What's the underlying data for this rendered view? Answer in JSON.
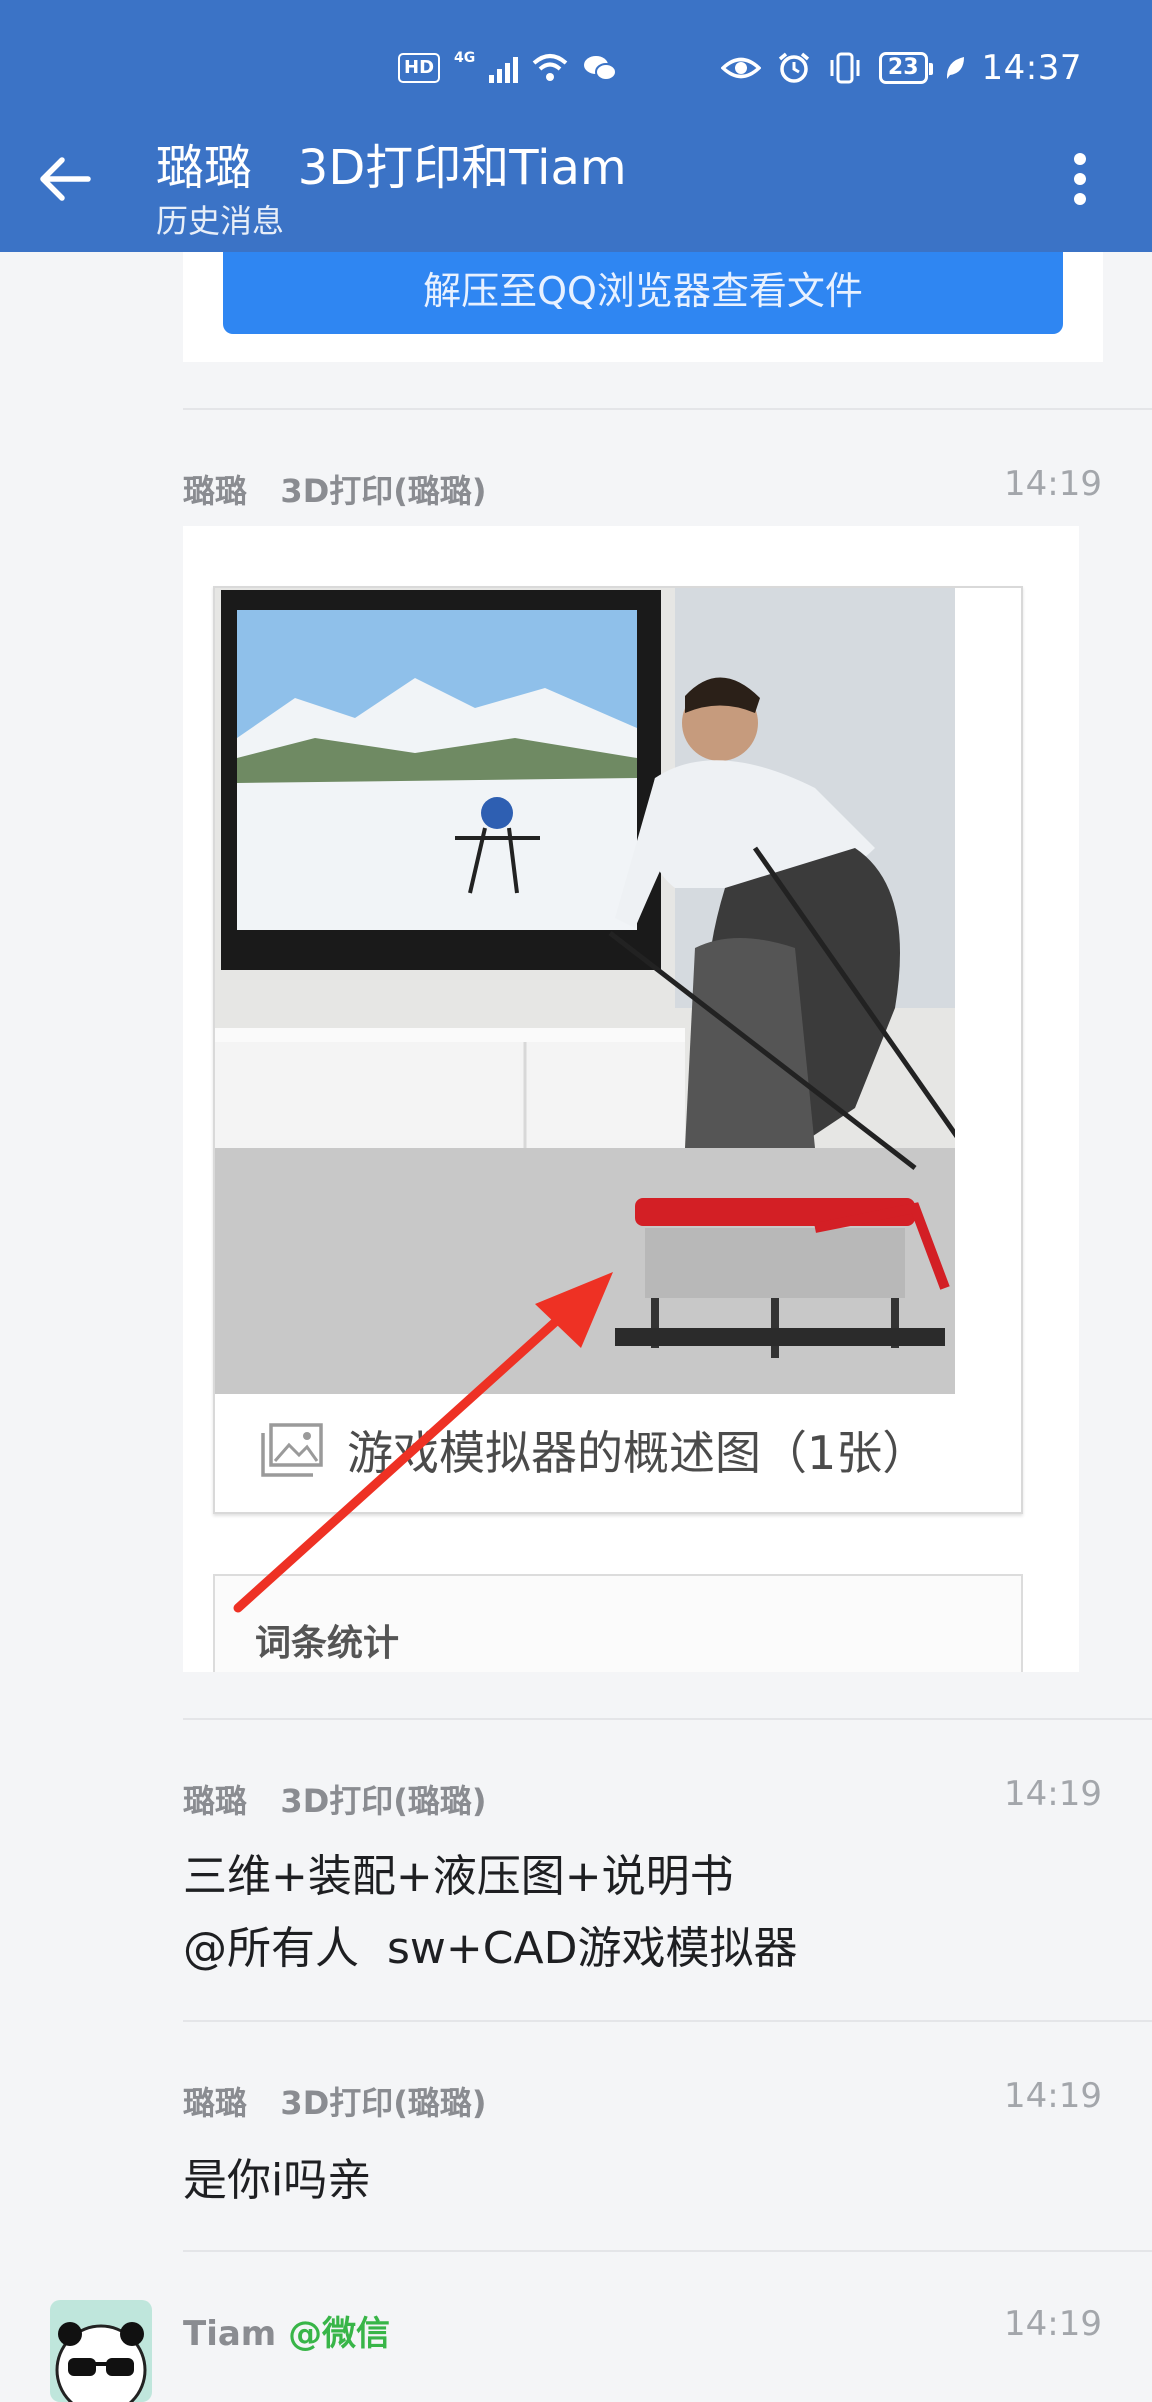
{
  "status_bar": {
    "hd": "HD",
    "network": "4G",
    "battery": "23",
    "time": "14:37"
  },
  "header": {
    "title": "璐璐   3D打印和Tiam",
    "subtitle": "历史消息"
  },
  "file_card": {
    "button_label": "解压至QQ浏览器查看文件"
  },
  "messages": [
    {
      "sender": "璐璐   3D打印(璐璐)",
      "time": "14:19",
      "type": "image",
      "image": {
        "caption": "游戏模拟器的概述图（1张）",
        "stats_title": "词条统计"
      }
    },
    {
      "sender": "璐璐   3D打印(璐璐)",
      "time": "14:19",
      "lines": [
        "三维+装配+液压图+说明书",
        "@所有人  sw+CAD游戏模拟器"
      ]
    },
    {
      "sender": "璐璐   3D打印(璐璐)",
      "time": "14:19",
      "lines": [
        "是你i吗亲"
      ]
    },
    {
      "sender": "Tiam",
      "sender_tag": "@微信",
      "time": "14:19"
    }
  ],
  "colors": {
    "header_bg": "#3b73c6",
    "button_bg": "#2f86f2",
    "wechat_tag": "#38b548",
    "arrow": "#ee3124"
  }
}
